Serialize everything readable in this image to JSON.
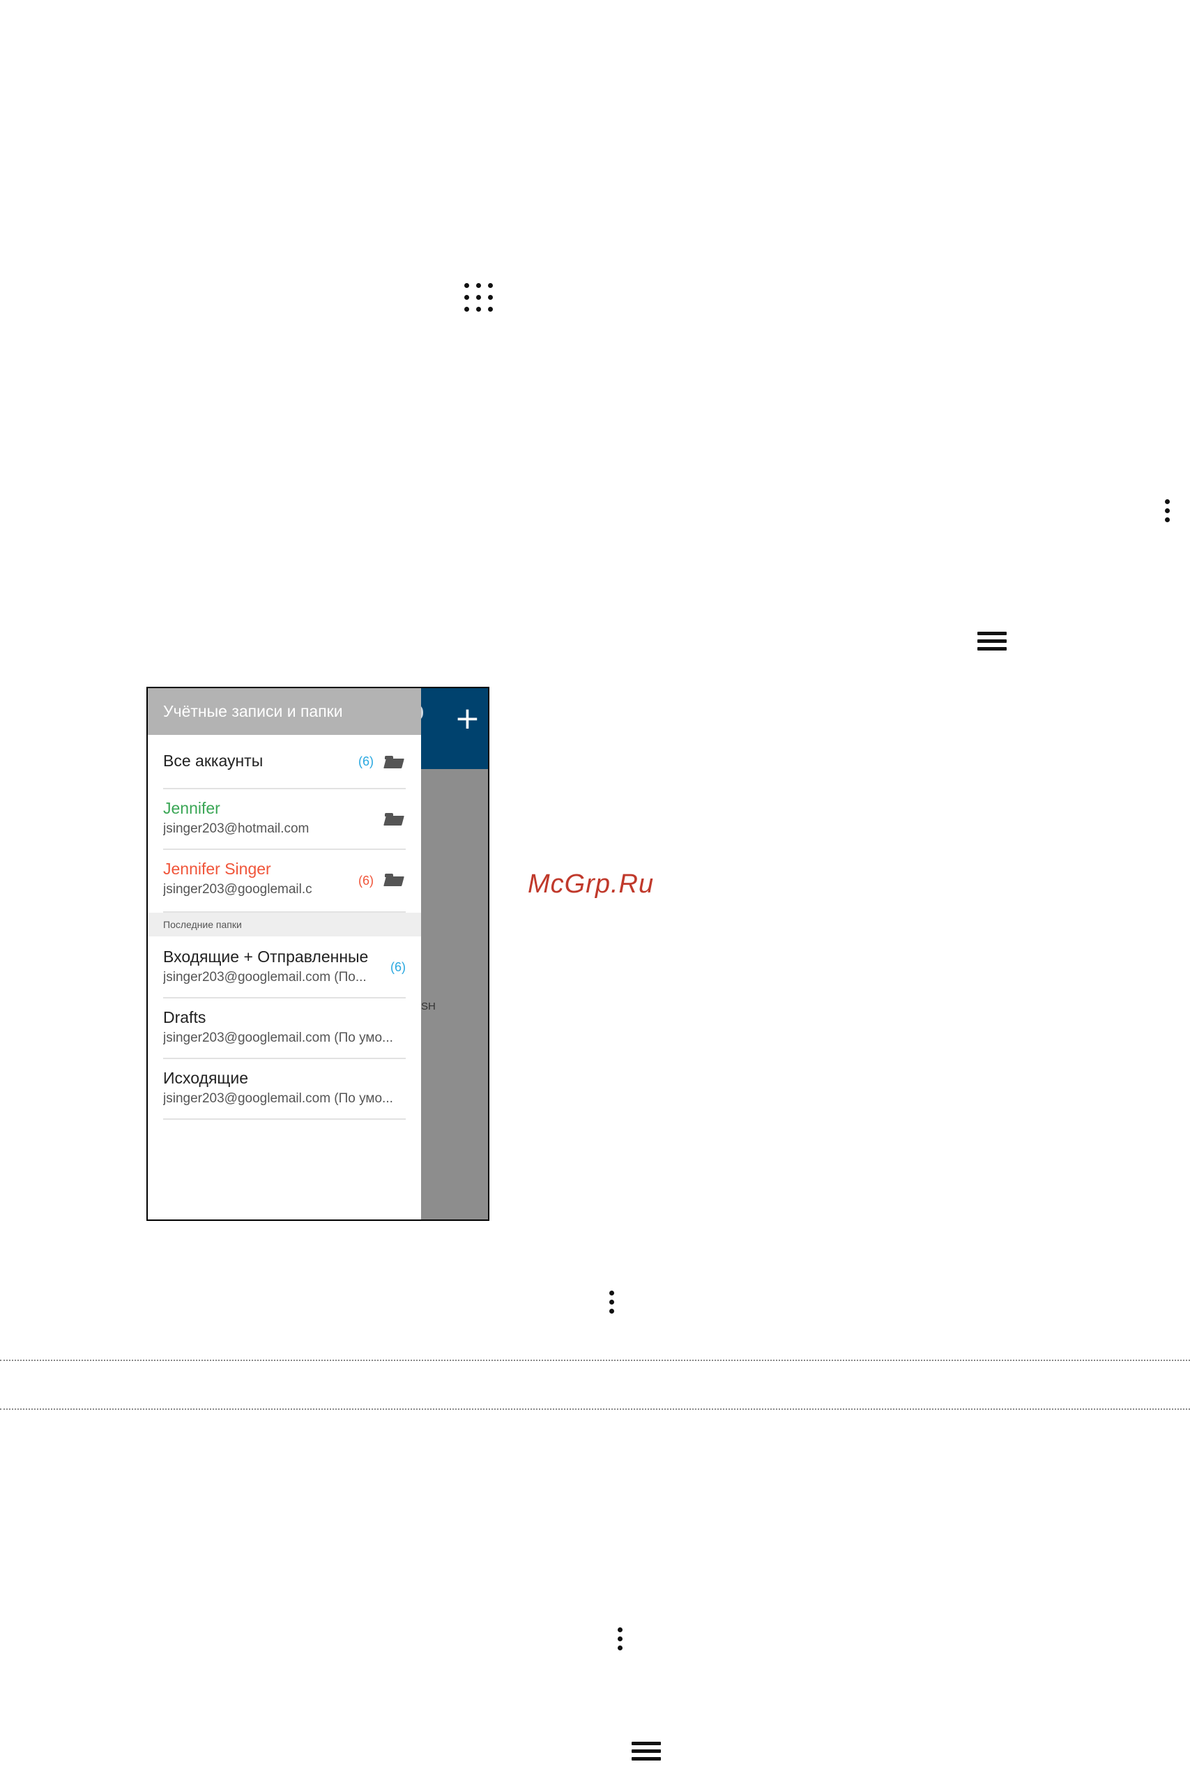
{
  "icons": {
    "apps": "apps-grid-icon",
    "more": "more-vertical-icon",
    "menu": "hamburger-menu-icon",
    "add": "plus-icon",
    "folder": "folder-open-icon"
  },
  "phone": {
    "add_glyph": "+",
    "partial_text": "SH",
    "drawer": {
      "header": "Учётные записи и папки",
      "accounts": [
        {
          "title": "Все аккаунты",
          "subtitle": "",
          "badge": "(6)",
          "title_color": "#222222",
          "badge_color": "#29a8e0"
        },
        {
          "title": "Jennifer",
          "subtitle": "jsinger203@hotmail.com",
          "badge": "",
          "title_color": "#3aa655",
          "badge_color": ""
        },
        {
          "title": "Jennifer Singer",
          "subtitle": "jsinger203@googlemail.c",
          "badge": "(6)",
          "title_color": "#f0553a",
          "badge_color": "#f0553a"
        }
      ],
      "section_label": "Последние папки",
      "recent": [
        {
          "title": "Входящие + Отправленные",
          "subtitle": "jsinger203@googlemail.com (По...",
          "badge": "(6)"
        },
        {
          "title": "Drafts",
          "subtitle": "jsinger203@googlemail.com (По умо...",
          "badge": ""
        },
        {
          "title": "Исходящие",
          "subtitle": "jsinger203@googlemail.com (По умо...",
          "badge": ""
        }
      ]
    }
  },
  "watermark": "McGrp.Ru",
  "colors": {
    "appbar": "#00426e",
    "drawer_header": "#b3b3b3",
    "scrim": "#8d8d8d",
    "badge_blue": "#29a8e0"
  }
}
